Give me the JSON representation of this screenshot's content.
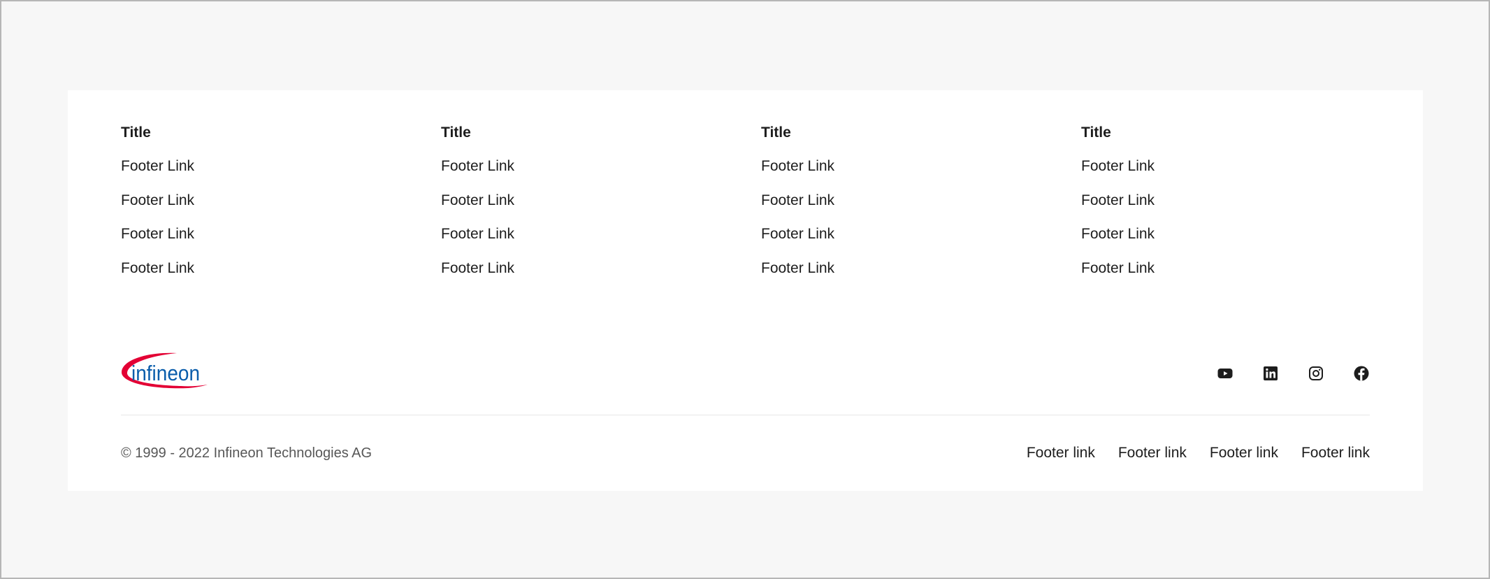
{
  "footer": {
    "columns": [
      {
        "title": "Title",
        "links": [
          "Footer Link",
          "Footer Link",
          "Footer Link",
          "Footer Link"
        ]
      },
      {
        "title": "Title",
        "links": [
          "Footer Link",
          "Footer Link",
          "Footer Link",
          "Footer Link"
        ]
      },
      {
        "title": "Title",
        "links": [
          "Footer Link",
          "Footer Link",
          "Footer Link",
          "Footer Link"
        ]
      },
      {
        "title": "Title",
        "links": [
          "Footer Link",
          "Footer Link",
          "Footer Link",
          "Footer Link"
        ]
      }
    ],
    "logo": {
      "text": "infineon",
      "icon": "infineon-logo",
      "colors": {
        "swoosh": "#e30034",
        "text": "#0a5dab"
      }
    },
    "social": [
      {
        "icon": "youtube-icon"
      },
      {
        "icon": "linkedin-icon"
      },
      {
        "icon": "instagram-icon"
      },
      {
        "icon": "facebook-icon"
      }
    ],
    "copyright": "© 1999 - 2022 Infineon Technologies AG",
    "bottom_links": [
      "Footer link",
      "Footer link",
      "Footer link",
      "Footer link"
    ]
  },
  "colors": {
    "page_background": "#f7f7f7",
    "card_background": "#ffffff",
    "text": "#1d1d1d",
    "muted_text": "#575757",
    "divider": "#e8e8e8"
  }
}
